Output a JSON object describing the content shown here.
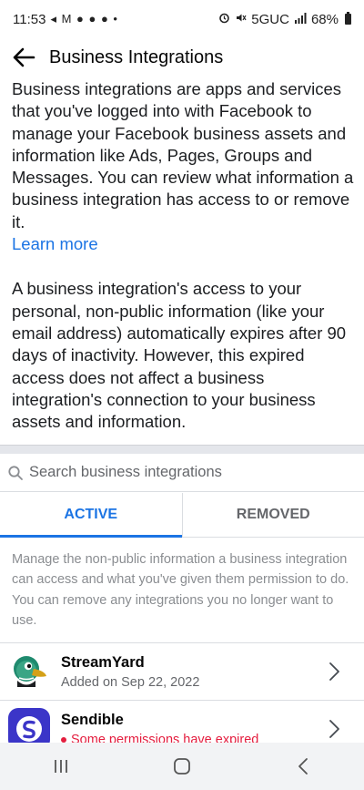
{
  "status_bar": {
    "time": "11:53",
    "left_icons": "◂ M ● ● ● •",
    "network": "5GUC",
    "battery": "68%"
  },
  "header": {
    "title": "Business Integrations"
  },
  "intro": {
    "paragraph1": "Business integrations are apps and services that you've logged into with Facebook to manage your Facebook business assets and information like Ads, Pages, Groups and Messages. You can review what information a business integration has access to or remove it.",
    "learn_more": "Learn more",
    "paragraph2": "A business integration's access to your personal, non-public information (like your email address) automatically expires after 90 days of inactivity. However, this expired access does not affect a business integration's connection to your business assets and information."
  },
  "search": {
    "placeholder": "Search business integrations"
  },
  "tabs": {
    "active": "ACTIVE",
    "removed": "REMOVED"
  },
  "note": "Manage the non-public information a business integration can access and what you've given them permission to do. You can remove any integrations you no longer want to use.",
  "integrations": [
    {
      "name": "StreamYard",
      "subtitle": "Added on Sep 22, 2022"
    },
    {
      "name": "Sendible",
      "subtitle": "Some permissions have expired"
    }
  ],
  "colors": {
    "accent": "#1b74e4",
    "warning": "#e41e3f",
    "secondary_text": "#65676b"
  }
}
